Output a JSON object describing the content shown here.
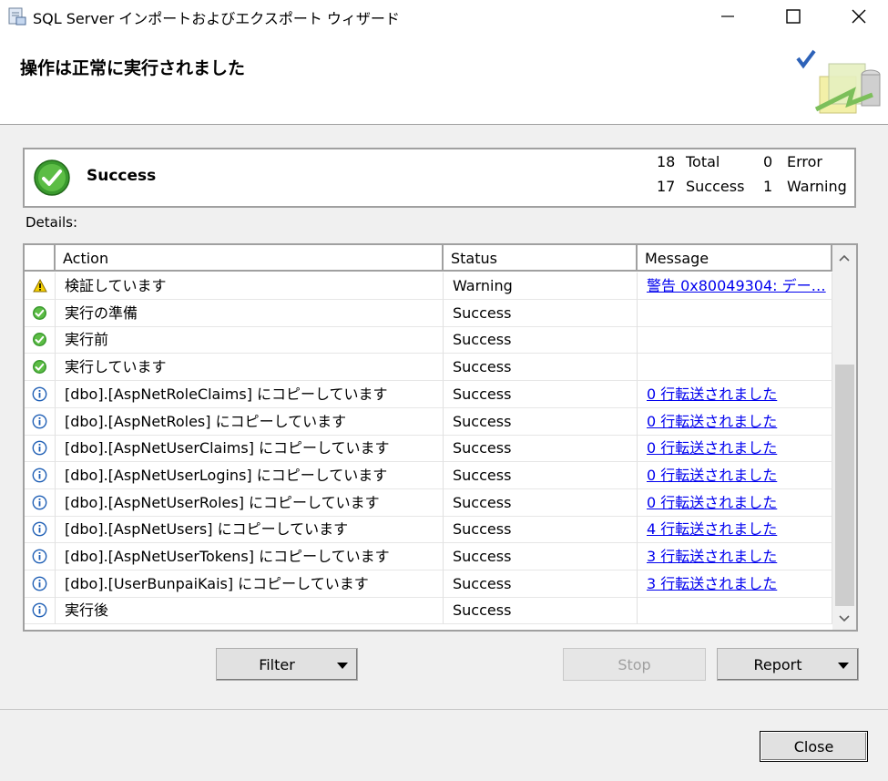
{
  "window": {
    "title": "SQL Server インポートおよびエクスポート ウィザード",
    "minimize_label": "—",
    "maximize_label": "☐",
    "close_label": "✕"
  },
  "header": {
    "title": "操作は正常に実行されました"
  },
  "summary": {
    "status": "Success",
    "total_count": "18",
    "total_label": "Total",
    "error_count": "0",
    "error_label": "Error",
    "success_count": "17",
    "success_label": "Success",
    "warning_count": "1",
    "warning_label": "Warning"
  },
  "details_label": "Details:",
  "grid": {
    "columns": [
      "Action",
      "Status",
      "Message"
    ],
    "rows": [
      {
        "icon": "warning-icon",
        "action": "検証しています",
        "status": "Warning",
        "message": "警告 0x80049304: デー…"
      },
      {
        "icon": "success-icon",
        "action": "実行の準備",
        "status": "Success",
        "message": ""
      },
      {
        "icon": "success-icon",
        "action": "実行前",
        "status": "Success",
        "message": ""
      },
      {
        "icon": "success-icon",
        "action": "実行しています",
        "status": "Success",
        "message": ""
      },
      {
        "icon": "info-icon",
        "action": "[dbo].[AspNetRoleClaims] にコピーしています",
        "status": "Success",
        "message": "0 行転送されました"
      },
      {
        "icon": "info-icon",
        "action": "[dbo].[AspNetRoles] にコピーしています",
        "status": "Success",
        "message": "0 行転送されました"
      },
      {
        "icon": "info-icon",
        "action": "[dbo].[AspNetUserClaims] にコピーしています",
        "status": "Success",
        "message": "0 行転送されました"
      },
      {
        "icon": "info-icon",
        "action": "[dbo].[AspNetUserLogins] にコピーしています",
        "status": "Success",
        "message": "0 行転送されました"
      },
      {
        "icon": "info-icon",
        "action": "[dbo].[AspNetUserRoles] にコピーしています",
        "status": "Success",
        "message": "0 行転送されました"
      },
      {
        "icon": "info-icon",
        "action": "[dbo].[AspNetUsers] にコピーしています",
        "status": "Success",
        "message": "4 行転送されました"
      },
      {
        "icon": "info-icon",
        "action": "[dbo].[AspNetUserTokens] にコピーしています",
        "status": "Success",
        "message": "3 行転送されました"
      },
      {
        "icon": "info-icon",
        "action": "[dbo].[UserBunpaiKais] にコピーしています",
        "status": "Success",
        "message": "3 行転送されました"
      },
      {
        "icon": "info-icon",
        "action": "実行後",
        "status": "Success",
        "message": ""
      }
    ]
  },
  "buttons": {
    "filter": "Filter",
    "stop": "Stop",
    "report": "Report",
    "close": "Close"
  },
  "colors": {
    "link": "#0000ee",
    "success_green": "#3a9a2e",
    "warning_yellow": "#f5d000",
    "info_blue": "#1f5fb5"
  }
}
